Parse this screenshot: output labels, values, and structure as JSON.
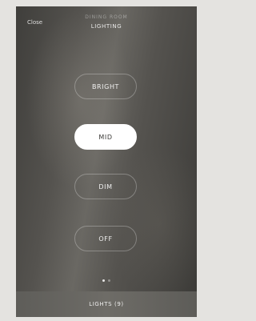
{
  "header": {
    "close_label": "Close",
    "room_name": "DINING ROOM",
    "title": "LIGHTING"
  },
  "scenes": {
    "bright": "BRIGHT",
    "mid": "MID",
    "dim": "DIM",
    "off": "OFF",
    "selected": "MID"
  },
  "pager": {
    "page_count": 2,
    "current_page": 1
  },
  "footer": {
    "lights_label": "LIGHTS (9)"
  },
  "colors": {
    "selected_button_bg": "#ffffff",
    "selected_button_text": "#3a3936",
    "outside_background": "#e4e3e0"
  }
}
